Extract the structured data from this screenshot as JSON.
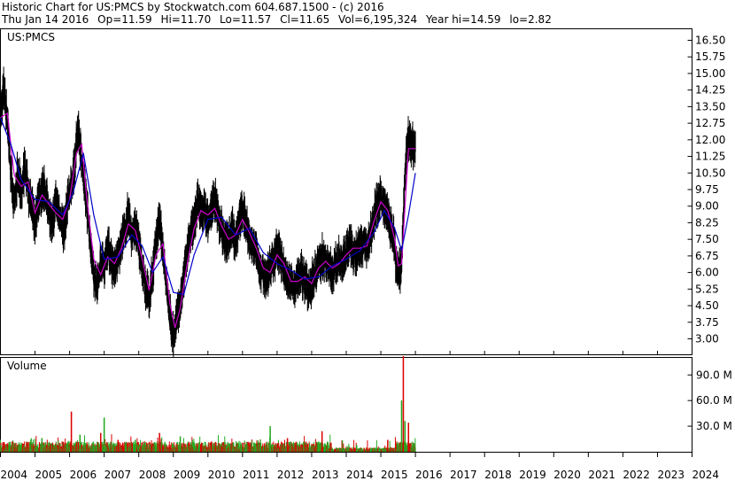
{
  "header": {
    "line1": "Historic Chart for US:PMCS by Stockwatch.com 604.687.1500 - (c) 2016",
    "date": "Thu Jan 14 2016",
    "op": "Op=11.59",
    "hi": "Hi=11.70",
    "lo": "Lo=11.57",
    "cl": "Cl=11.65",
    "vol": "Vol=6,195,324",
    "yearhi": "Year hi=14.59",
    "yearlo": "lo=2.82"
  },
  "colors": {
    "price": "#000000",
    "ma_fast": "#cc00cc",
    "ma_slow": "#0000cc",
    "vol_up": "#22aa22",
    "vol_down": "#dd0000",
    "grid": "#000000"
  },
  "chart_data": [
    {
      "type": "line",
      "title": "US:PMCS",
      "ylim": [
        2.3,
        17.0
      ],
      "yticks": [
        "16.50",
        "15.75",
        "15.00",
        "14.25",
        "13.50",
        "12.75",
        "12.00",
        "11.25",
        "10.50",
        "9.75",
        "9.00",
        "8.25",
        "7.50",
        "6.75",
        "6.00",
        "5.25",
        "4.50",
        "3.75",
        "3.00"
      ],
      "x_range": [
        2004.0,
        2024.0
      ],
      "series": [
        {
          "key": "price",
          "points": [
            [
              2004.0,
              13.1
            ],
            [
              2004.1,
              14.3
            ],
            [
              2004.2,
              13.0
            ],
            [
              2004.3,
              10.5
            ],
            [
              2004.4,
              9.0
            ],
            [
              2004.5,
              10.5
            ],
            [
              2004.6,
              9.6
            ],
            [
              2004.7,
              10.8
            ],
            [
              2004.8,
              9.8
            ],
            [
              2004.9,
              8.9
            ],
            [
              2005.0,
              8.2
            ],
            [
              2005.1,
              9.3
            ],
            [
              2005.25,
              9.9
            ],
            [
              2005.4,
              8.9
            ],
            [
              2005.5,
              8.1
            ],
            [
              2005.6,
              9.2
            ],
            [
              2005.75,
              8.4
            ],
            [
              2005.85,
              7.9
            ],
            [
              2005.95,
              9.3
            ],
            [
              2006.05,
              9.8
            ],
            [
              2006.15,
              11.0
            ],
            [
              2006.25,
              12.6
            ],
            [
              2006.35,
              11.0
            ],
            [
              2006.5,
              9.0
            ],
            [
              2006.6,
              7.3
            ],
            [
              2006.7,
              6.0
            ],
            [
              2006.8,
              5.3
            ],
            [
              2006.9,
              6.5
            ],
            [
              2007.0,
              6.3
            ],
            [
              2007.1,
              7.3
            ],
            [
              2007.2,
              6.6
            ],
            [
              2007.3,
              6.1
            ],
            [
              2007.4,
              6.7
            ],
            [
              2007.5,
              7.3
            ],
            [
              2007.6,
              7.9
            ],
            [
              2007.7,
              8.7
            ],
            [
              2007.8,
              7.6
            ],
            [
              2007.9,
              8.2
            ],
            [
              2008.0,
              7.2
            ],
            [
              2008.1,
              6.3
            ],
            [
              2008.2,
              5.3
            ],
            [
              2008.3,
              4.8
            ],
            [
              2008.4,
              5.9
            ],
            [
              2008.5,
              7.6
            ],
            [
              2008.6,
              8.2
            ],
            [
              2008.7,
              7.0
            ],
            [
              2008.8,
              5.5
            ],
            [
              2008.9,
              4.0
            ],
            [
              2009.0,
              3.1
            ],
            [
              2009.1,
              3.9
            ],
            [
              2009.2,
              4.6
            ],
            [
              2009.3,
              5.7
            ],
            [
              2009.4,
              6.9
            ],
            [
              2009.5,
              7.6
            ],
            [
              2009.6,
              8.3
            ],
            [
              2009.7,
              9.2
            ],
            [
              2009.8,
              8.6
            ],
            [
              2009.9,
              9.0
            ],
            [
              2010.0,
              8.2
            ],
            [
              2010.1,
              8.8
            ],
            [
              2010.2,
              9.3
            ],
            [
              2010.3,
              8.5
            ],
            [
              2010.4,
              7.9
            ],
            [
              2010.5,
              7.3
            ],
            [
              2010.6,
              7.6
            ],
            [
              2010.7,
              8.1
            ],
            [
              2010.8,
              7.4
            ],
            [
              2010.9,
              8.3
            ],
            [
              2011.0,
              8.8
            ],
            [
              2011.1,
              8.2
            ],
            [
              2011.2,
              7.6
            ],
            [
              2011.3,
              7.3
            ],
            [
              2011.4,
              7.0
            ],
            [
              2011.5,
              6.2
            ],
            [
              2011.6,
              6.0
            ],
            [
              2011.7,
              5.6
            ],
            [
              2011.8,
              6.2
            ],
            [
              2011.9,
              6.5
            ],
            [
              2012.0,
              7.0
            ],
            [
              2012.1,
              6.8
            ],
            [
              2012.2,
              6.2
            ],
            [
              2012.3,
              5.6
            ],
            [
              2012.4,
              5.5
            ],
            [
              2012.5,
              5.3
            ],
            [
              2012.6,
              5.8
            ],
            [
              2012.7,
              6.0
            ],
            [
              2012.8,
              5.6
            ],
            [
              2012.9,
              5.2
            ],
            [
              2013.0,
              5.5
            ],
            [
              2013.1,
              6.0
            ],
            [
              2013.2,
              6.4
            ],
            [
              2013.3,
              6.7
            ],
            [
              2013.4,
              6.5
            ],
            [
              2013.5,
              6.3
            ],
            [
              2013.6,
              6.0
            ],
            [
              2013.7,
              6.3
            ],
            [
              2013.8,
              6.6
            ],
            [
              2013.9,
              6.5
            ],
            [
              2014.0,
              6.9
            ],
            [
              2014.1,
              7.3
            ],
            [
              2014.2,
              7.0
            ],
            [
              2014.3,
              6.9
            ],
            [
              2014.4,
              7.2
            ],
            [
              2014.5,
              7.4
            ],
            [
              2014.6,
              7.0
            ],
            [
              2014.7,
              7.7
            ],
            [
              2014.8,
              8.6
            ],
            [
              2014.9,
              9.1
            ],
            [
              2015.0,
              9.4
            ],
            [
              2015.1,
              9.0
            ],
            [
              2015.2,
              8.6
            ],
            [
              2015.3,
              8.0
            ],
            [
              2015.4,
              7.2
            ],
            [
              2015.45,
              6.1
            ],
            [
              2015.55,
              6.0
            ],
            [
              2015.6,
              6.4
            ],
            [
              2015.65,
              8.5
            ],
            [
              2015.7,
              10.3
            ],
            [
              2015.75,
              11.8
            ],
            [
              2015.8,
              12.0
            ],
            [
              2015.9,
              11.8
            ],
            [
              2016.0,
              11.6
            ]
          ]
        },
        {
          "key": "ma_fast",
          "points": [
            [
              2004.0,
              13.0
            ],
            [
              2004.2,
              13.2
            ],
            [
              2004.4,
              10.4
            ],
            [
              2004.6,
              9.9
            ],
            [
              2004.8,
              10.1
            ],
            [
              2005.0,
              8.7
            ],
            [
              2005.2,
              9.5
            ],
            [
              2005.4,
              9.1
            ],
            [
              2005.6,
              8.7
            ],
            [
              2005.8,
              8.4
            ],
            [
              2006.0,
              9.3
            ],
            [
              2006.2,
              11.4
            ],
            [
              2006.35,
              11.8
            ],
            [
              2006.5,
              9.3
            ],
            [
              2006.7,
              6.6
            ],
            [
              2006.9,
              5.9
            ],
            [
              2007.1,
              6.7
            ],
            [
              2007.3,
              6.4
            ],
            [
              2007.5,
              7.1
            ],
            [
              2007.7,
              8.2
            ],
            [
              2007.9,
              7.9
            ],
            [
              2008.1,
              6.6
            ],
            [
              2008.3,
              5.2
            ],
            [
              2008.5,
              6.8
            ],
            [
              2008.7,
              7.3
            ],
            [
              2008.9,
              4.6
            ],
            [
              2009.05,
              3.5
            ],
            [
              2009.2,
              4.4
            ],
            [
              2009.4,
              6.4
            ],
            [
              2009.6,
              8.0
            ],
            [
              2009.8,
              8.8
            ],
            [
              2010.0,
              8.6
            ],
            [
              2010.2,
              8.9
            ],
            [
              2010.4,
              8.1
            ],
            [
              2010.6,
              7.5
            ],
            [
              2010.8,
              7.7
            ],
            [
              2011.0,
              8.4
            ],
            [
              2011.2,
              7.8
            ],
            [
              2011.4,
              7.1
            ],
            [
              2011.6,
              6.2
            ],
            [
              2011.8,
              6.0
            ],
            [
              2012.0,
              6.8
            ],
            [
              2012.2,
              6.4
            ],
            [
              2012.4,
              5.6
            ],
            [
              2012.6,
              5.6
            ],
            [
              2012.8,
              5.8
            ],
            [
              2013.0,
              5.5
            ],
            [
              2013.2,
              6.2
            ],
            [
              2013.4,
              6.5
            ],
            [
              2013.6,
              6.2
            ],
            [
              2013.8,
              6.4
            ],
            [
              2014.0,
              6.8
            ],
            [
              2014.2,
              7.1
            ],
            [
              2014.4,
              7.1
            ],
            [
              2014.6,
              7.2
            ],
            [
              2014.8,
              8.3
            ],
            [
              2015.0,
              9.2
            ],
            [
              2015.2,
              8.8
            ],
            [
              2015.4,
              7.5
            ],
            [
              2015.5,
              6.3
            ],
            [
              2015.6,
              6.4
            ],
            [
              2015.7,
              9.0
            ],
            [
              2015.8,
              11.6
            ],
            [
              2016.0,
              11.6
            ]
          ]
        },
        {
          "key": "ma_slow",
          "points": [
            [
              2004.0,
              13.0
            ],
            [
              2004.3,
              11.8
            ],
            [
              2004.6,
              10.2
            ],
            [
              2005.0,
              9.3
            ],
            [
              2005.4,
              9.2
            ],
            [
              2005.8,
              8.6
            ],
            [
              2006.1,
              9.6
            ],
            [
              2006.4,
              11.4
            ],
            [
              2006.7,
              8.6
            ],
            [
              2007.0,
              6.6
            ],
            [
              2007.4,
              6.7
            ],
            [
              2007.8,
              7.7
            ],
            [
              2008.1,
              7.2
            ],
            [
              2008.4,
              6.0
            ],
            [
              2008.7,
              6.7
            ],
            [
              2009.0,
              5.1
            ],
            [
              2009.3,
              5.0
            ],
            [
              2009.6,
              6.8
            ],
            [
              2010.0,
              8.4
            ],
            [
              2010.4,
              8.5
            ],
            [
              2010.8,
              7.7
            ],
            [
              2011.2,
              8.0
            ],
            [
              2011.6,
              6.9
            ],
            [
              2012.0,
              6.4
            ],
            [
              2012.4,
              6.1
            ],
            [
              2012.8,
              5.7
            ],
            [
              2013.2,
              5.8
            ],
            [
              2013.6,
              6.3
            ],
            [
              2014.0,
              6.6
            ],
            [
              2014.4,
              7.0
            ],
            [
              2014.8,
              7.8
            ],
            [
              2015.1,
              8.8
            ],
            [
              2015.4,
              8.0
            ],
            [
              2015.6,
              7.0
            ],
            [
              2015.8,
              8.6
            ],
            [
              2016.0,
              10.5
            ]
          ]
        }
      ]
    },
    {
      "type": "bar",
      "title": "Volume",
      "ylim": [
        0,
        110
      ],
      "yticks": [
        "90.0 M",
        "60.0 M",
        "30.0 M"
      ],
      "note_units": "M",
      "volume_peaks": [
        [
          2005.2,
          16
        ],
        [
          2006.05,
          47
        ],
        [
          2006.3,
          20
        ],
        [
          2006.9,
          22
        ],
        [
          2007.0,
          40
        ],
        [
          2007.4,
          14
        ],
        [
          2007.9,
          14
        ],
        [
          2008.6,
          22
        ],
        [
          2009.2,
          18
        ],
        [
          2010.1,
          12
        ],
        [
          2011.8,
          30
        ],
        [
          2012.3,
          16
        ],
        [
          2013.2,
          12
        ],
        [
          2013.3,
          24
        ],
        [
          2014.3,
          8
        ],
        [
          2015.2,
          14
        ],
        [
          2015.6,
          60
        ],
        [
          2015.65,
          112
        ],
        [
          2015.7,
          36
        ],
        [
          2015.8,
          34
        ]
      ]
    }
  ],
  "xticks": [
    "2004",
    "2005",
    "2006",
    "2007",
    "2008",
    "2009",
    "2010",
    "2011",
    "2012",
    "2013",
    "2014",
    "2015",
    "2016",
    "2017",
    "2018",
    "2019",
    "2020",
    "2021",
    "2022",
    "2023",
    "2024"
  ]
}
